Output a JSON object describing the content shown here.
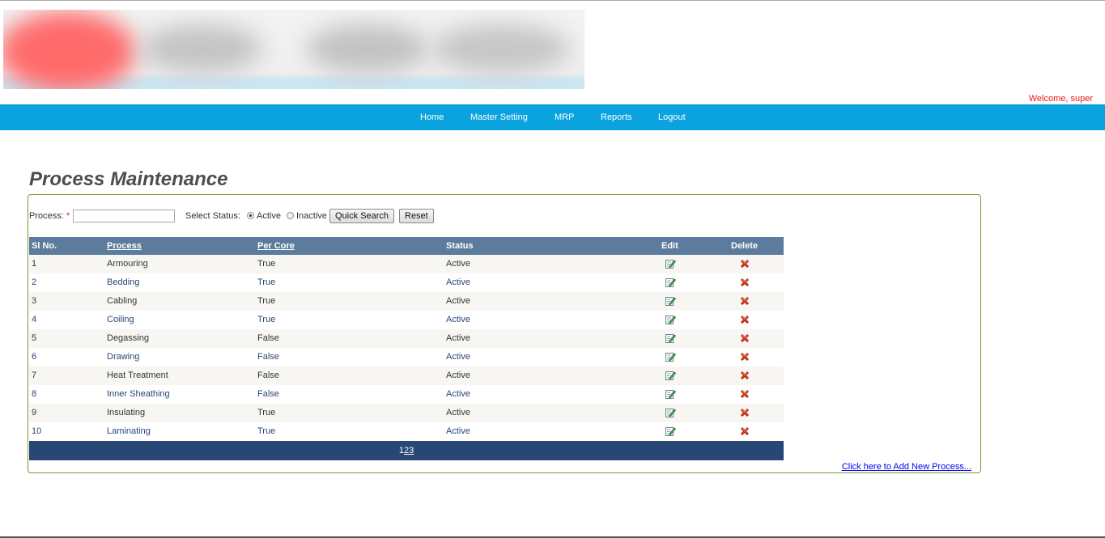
{
  "header": {
    "welcome": "Welcome, super"
  },
  "nav": {
    "items": [
      "Home",
      "Master Setting",
      "MRP",
      "Reports",
      "Logout"
    ]
  },
  "page": {
    "title": "Process Maintenance"
  },
  "filter": {
    "process_label": "Process:",
    "required_mark": "*",
    "process_value": "",
    "status_label": "Select Status:",
    "status_options": [
      "Active",
      "Inactive"
    ],
    "status_selected": "Active",
    "quick_search": "Quick Search",
    "reset": "Reset"
  },
  "table": {
    "headers": {
      "sl": "Sl No.",
      "process": "Process",
      "per_core": "Per Core",
      "status": "Status",
      "edit": "Edit",
      "delete": "Delete"
    },
    "rows": [
      {
        "sl": "1",
        "process": "Armouring",
        "per_core": "True",
        "status": "Active"
      },
      {
        "sl": "2",
        "process": "Bedding",
        "per_core": "True",
        "status": "Active"
      },
      {
        "sl": "3",
        "process": "Cabling",
        "per_core": "True",
        "status": "Active"
      },
      {
        "sl": "4",
        "process": "Coiling",
        "per_core": "True",
        "status": "Active"
      },
      {
        "sl": "5",
        "process": "Degassing",
        "per_core": "False",
        "status": "Active"
      },
      {
        "sl": "6",
        "process": "Drawing",
        "per_core": "False",
        "status": "Active"
      },
      {
        "sl": "7",
        "process": "Heat Treatment",
        "per_core": "False",
        "status": "Active"
      },
      {
        "sl": "8",
        "process": "Inner Sheathing",
        "per_core": "False",
        "status": "Active"
      },
      {
        "sl": "9",
        "process": "Insulating",
        "per_core": "True",
        "status": "Active"
      },
      {
        "sl": "10",
        "process": "Laminating",
        "per_core": "True",
        "status": "Active"
      }
    ],
    "icons": {
      "edit": "edit-icon",
      "delete": "delete-icon"
    },
    "pager": {
      "pages": [
        "1",
        "2",
        "3"
      ],
      "current": "1"
    }
  },
  "add_link": "Click here to Add New Process...",
  "colors": {
    "nav_bg": "#0aa3dd",
    "header_row": "#5d7b9d",
    "pager_bg": "#284775",
    "panel_border": "#7a9a29",
    "welcome": "#e41b17"
  }
}
